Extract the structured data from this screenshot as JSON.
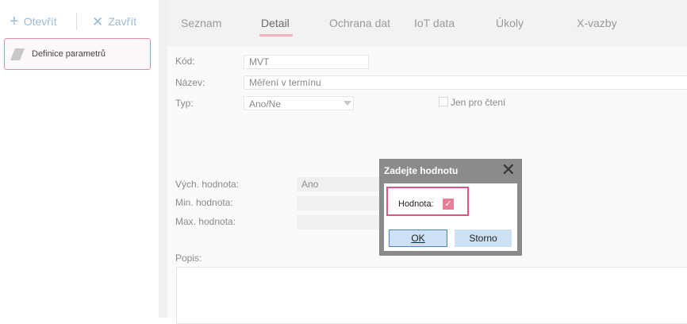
{
  "toolbar": {
    "open_label": "Otevřít",
    "close_label": "Zavřít",
    "open_icon": "plus-icon",
    "close_icon": "x-icon"
  },
  "tree": {
    "item_label": "Definice parametrů",
    "item_icon": "leaf-icon"
  },
  "tabs": [
    {
      "label": "Seznam"
    },
    {
      "label": "Detail",
      "active": true
    },
    {
      "label": "Ochrana dat"
    },
    {
      "label": "IoT data"
    },
    {
      "label": "Úkoly"
    },
    {
      "label": "X-vazby"
    }
  ],
  "form": {
    "kod_label": "Kód:",
    "kod_value": "MVT",
    "nazev_label": "Název:",
    "nazev_value": "Měření v termínu",
    "typ_label": "Typ:",
    "typ_value": "Ano/Ne",
    "readonly_label": "Jen pro čtení",
    "vych_label": "Vých. hodnota:",
    "vych_value": "Ano",
    "min_label": "Min. hodnota:",
    "max_label": "Max. hodnota:",
    "popis_label": "Popis:"
  },
  "dialog": {
    "title": "Zadejte hodnotu",
    "value_label": "Hodnota:",
    "value_checked": true,
    "ok_label": "OK",
    "cancel_label": "Storno"
  },
  "colors": {
    "accent": "#e05580",
    "checkbox": "#e77d96",
    "button_bg": "#cde1f5",
    "toolbar_text": "#9bbbd6"
  }
}
